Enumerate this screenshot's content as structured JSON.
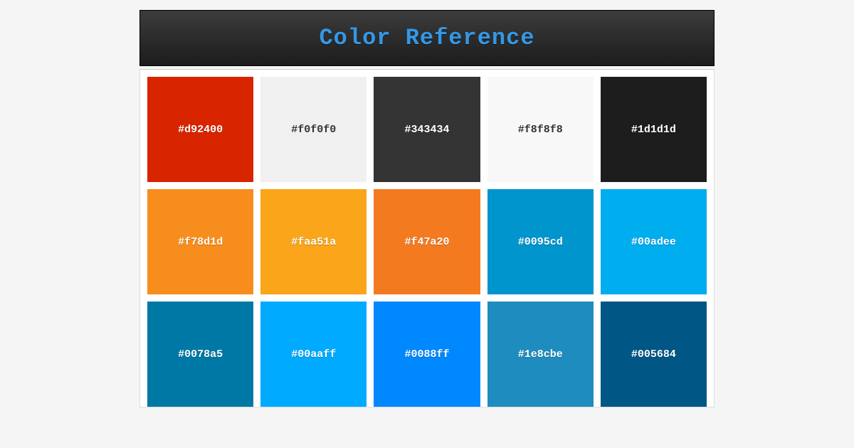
{
  "header": {
    "title": "Color Reference"
  },
  "swatches": [
    {
      "hex": "#d92400",
      "label": "#d92400",
      "text": "#ffffff"
    },
    {
      "hex": "#f0f0f0",
      "label": "#f0f0f0",
      "text": "#333333"
    },
    {
      "hex": "#343434",
      "label": "#343434",
      "text": "#ffffff"
    },
    {
      "hex": "#f8f8f8",
      "label": "#f8f8f8",
      "text": "#333333"
    },
    {
      "hex": "#1d1d1d",
      "label": "#1d1d1d",
      "text": "#ffffff"
    },
    {
      "hex": "#f78d1d",
      "label": "#f78d1d",
      "text": "#ffffff"
    },
    {
      "hex": "#faa51a",
      "label": "#faa51a",
      "text": "#ffffff"
    },
    {
      "hex": "#f47a20",
      "label": "#f47a20",
      "text": "#ffffff"
    },
    {
      "hex": "#0095cd",
      "label": "#0095cd",
      "text": "#ffffff"
    },
    {
      "hex": "#00adee",
      "label": "#00adee",
      "text": "#ffffff"
    },
    {
      "hex": "#0078a5",
      "label": "#0078a5",
      "text": "#ffffff"
    },
    {
      "hex": "#00aaff",
      "label": "#00aaff",
      "text": "#ffffff"
    },
    {
      "hex": "#0088ff",
      "label": "#0088ff",
      "text": "#ffffff"
    },
    {
      "hex": "#1e8cbe",
      "label": "#1e8cbe",
      "text": "#ffffff"
    },
    {
      "hex": "#005684",
      "label": "#005684",
      "text": "#ffffff"
    }
  ]
}
